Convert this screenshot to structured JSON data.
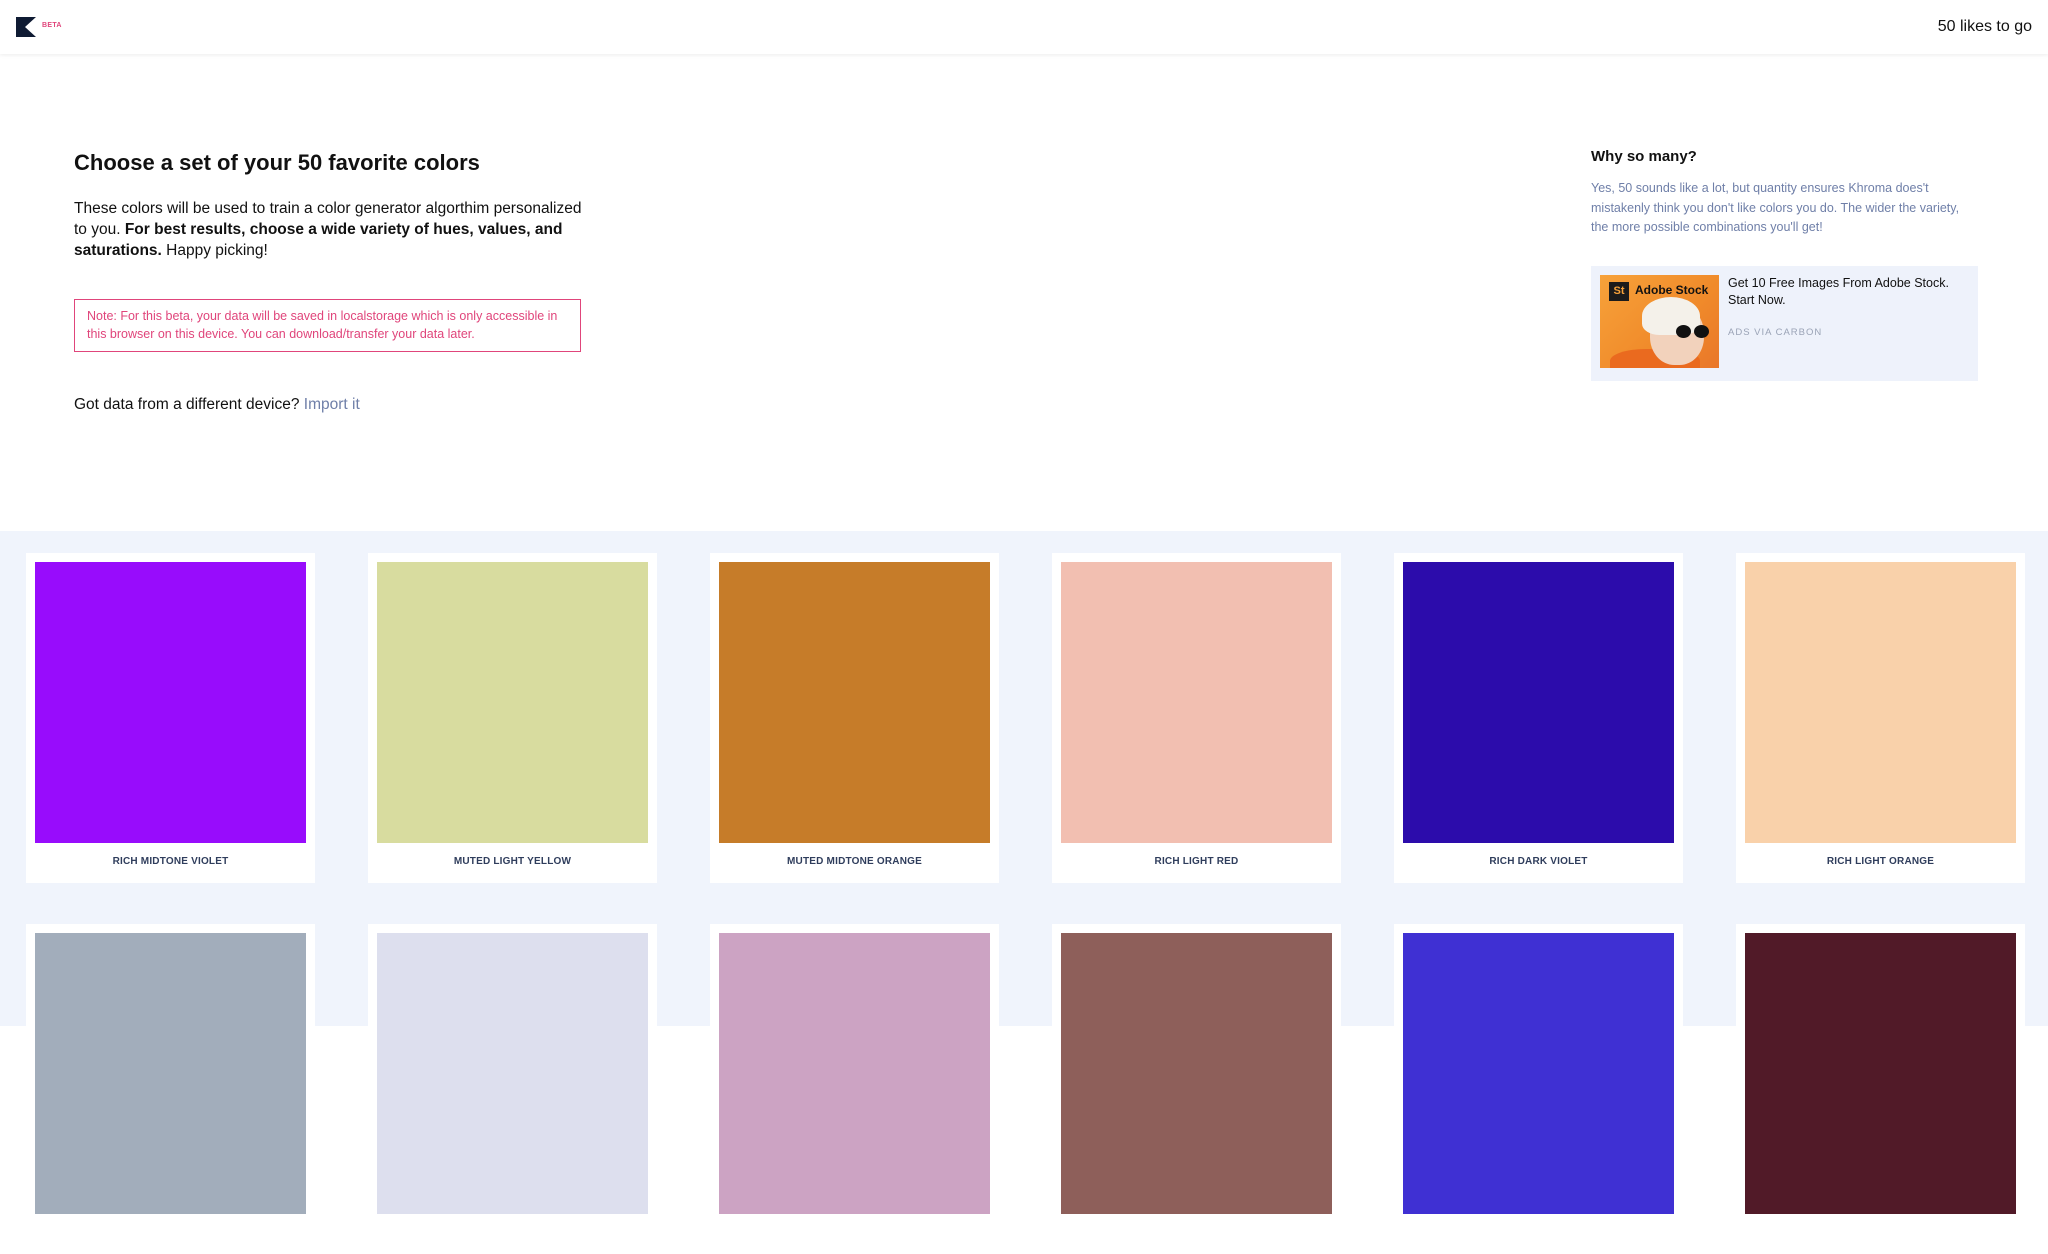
{
  "header": {
    "beta_label": "BETA",
    "likes_to_go": "50 likes to go"
  },
  "intro": {
    "title": "Choose a set of your 50 favorite colors",
    "desc_plain": "These colors will be used to train a color generator algorthim personalized to you.",
    "desc_bold": "For best results, choose a wide variety of hues, values, and saturations.",
    "desc_tail": "Happy picking!",
    "note": "Note: For this beta, your data will be saved in localstorage which is only accessible in this browser on this device. You can download/transfer your data later.",
    "import_prompt": "Got data from a different device?",
    "import_link": "Import it"
  },
  "aside": {
    "title": "Why so many?",
    "body": "Yes, 50 sounds like a lot, but quantity ensures Khroma does't mistakenly think you don't like colors you do. The wider the variety, the more possible combinations you'll get!",
    "ad": {
      "image_badge": "St",
      "image_brand": "Adobe Stock",
      "title": "Get 10 Free Images From Adobe Stock. Start Now.",
      "via": "ADS VIA CARBON"
    }
  },
  "colors": [
    {
      "label": "RICH MIDTONE VIOLET",
      "hex": "#980cfc"
    },
    {
      "label": "MUTED LIGHT YELLOW",
      "hex": "#d8dc9f"
    },
    {
      "label": "MUTED MIDTONE ORANGE",
      "hex": "#c67c29"
    },
    {
      "label": "RICH LIGHT RED",
      "hex": "#f2bfb1"
    },
    {
      "label": "RICH DARK VIOLET",
      "hex": "#2c0cab"
    },
    {
      "label": "RICH LIGHT ORANGE",
      "hex": "#f9d1aa"
    },
    {
      "label": "",
      "hex": "#a2adbb"
    },
    {
      "label": "",
      "hex": "#dddfee"
    },
    {
      "label": "",
      "hex": "#cca3c3"
    },
    {
      "label": "",
      "hex": "#8e5f5a"
    },
    {
      "label": "",
      "hex": "#3f30d3"
    },
    {
      "label": "",
      "hex": "#511a28"
    }
  ]
}
